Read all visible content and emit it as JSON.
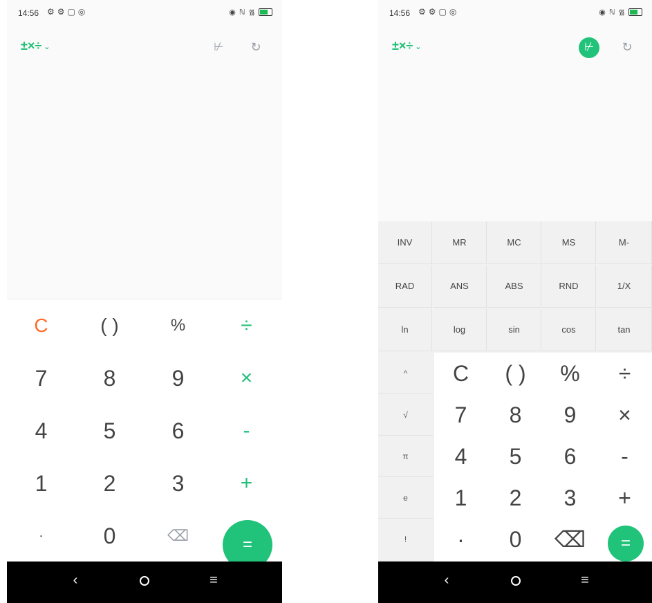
{
  "status_bar": {
    "time": "14:56",
    "left_icons": [
      "⚙",
      "⚙",
      "▢",
      "◎"
    ],
    "right_icons": [
      "◉",
      "ℕ",
      "᯾"
    ]
  },
  "toolbar": {
    "mode_icon": "±×÷",
    "mode_chevron": "⌄",
    "sci_icon": "⊬",
    "history_icon": "↻"
  },
  "keypad": {
    "rows": [
      [
        "C",
        "( )",
        "%",
        "÷"
      ],
      [
        "7",
        "8",
        "9",
        "×"
      ],
      [
        "4",
        "5",
        "6",
        "-"
      ],
      [
        "1",
        "2",
        "3",
        "+"
      ],
      [
        "·",
        "0",
        "⌫",
        "="
      ]
    ]
  },
  "sci_panel": {
    "rows": [
      [
        "INV",
        "MR",
        "MC",
        "MS",
        "M-"
      ],
      [
        "RAD",
        "ANS",
        "ABS",
        "RND",
        "1/X"
      ],
      [
        "ln",
        "log",
        "sin",
        "cos",
        "tan"
      ]
    ],
    "side": [
      "^",
      "√",
      "π",
      "e",
      "!"
    ]
  },
  "navbar": {
    "back": "‹",
    "recents": "≡"
  },
  "colors": {
    "accent": "#21c27a",
    "clear": "#ff6a2b",
    "nav_bg": "#000000"
  }
}
